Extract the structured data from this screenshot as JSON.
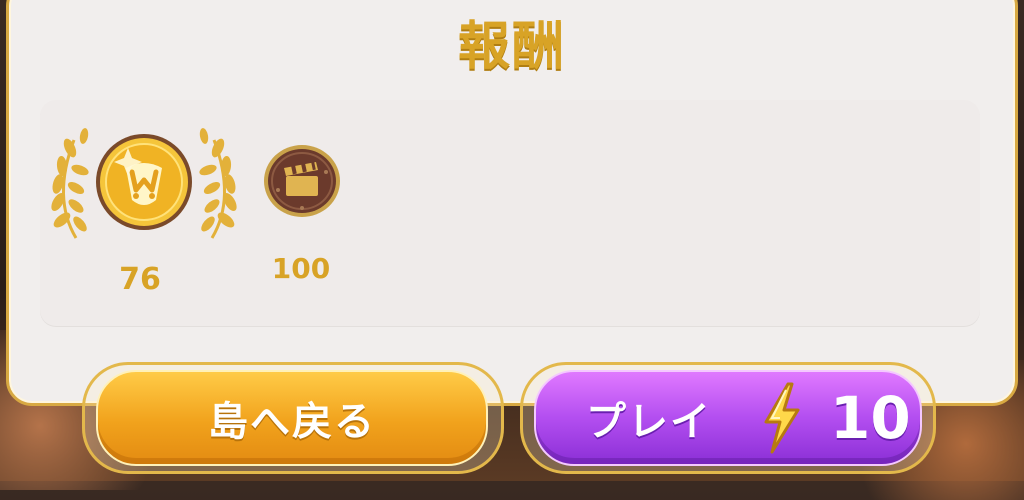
{
  "panel": {
    "title": "報酬"
  },
  "rewards": [
    {
      "icon": "gold-coin-icon",
      "count": "76"
    },
    {
      "icon": "clapperboard-coin-icon",
      "count": "100"
    }
  ],
  "buttons": {
    "back_label": "島へ戻る",
    "play_label": "プレイ",
    "play_cost": "10",
    "play_cost_icon": "lightning-bolt-icon"
  },
  "colors": {
    "gold": "#d8a326",
    "orange_button": "#f1a21c",
    "purple_button": "#b34ef0",
    "panel_bg": "#f1eeed"
  }
}
